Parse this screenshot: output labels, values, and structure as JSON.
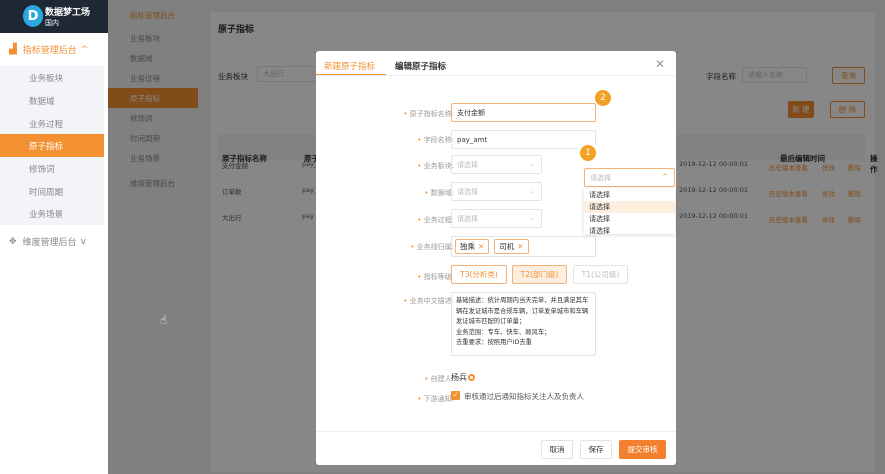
{
  "app": {
    "name": "数据梦工场",
    "region": "国内"
  },
  "nav": {
    "group1": "指标管理后台",
    "items": [
      "业务板块",
      "数据域",
      "业务过程",
      "原子指标",
      "修饰词",
      "时间周期",
      "业务场景"
    ],
    "active": 3,
    "group2": "维度管理后台"
  },
  "page": {
    "title": "原子指标",
    "filter_label": "业务板块",
    "filter_value": "大出行",
    "field_label": "字段名称",
    "field_placeholder": "请输入名称",
    "query": "查询",
    "new": "新 建",
    "delete": "删 除",
    "columns": [
      "原子指标名称",
      "原子",
      "最后编辑时间",
      "操作"
    ],
    "rows": [
      {
        "name": "支付金额",
        "code": "pay_",
        "time": "2019-12-12 00:00:01"
      },
      {
        "name": "订单数",
        "code": "pay_",
        "time": "2019-12-12 00:00:01"
      },
      {
        "name": "大出行",
        "code": "pay",
        "time": "2019-12-12 00:00:01"
      }
    ],
    "ops": [
      "历史版本查看",
      "修改",
      "删除"
    ]
  },
  "modal": {
    "tabs": [
      "新建原子指标",
      "编辑原子指标"
    ],
    "active_tab": 0,
    "labels": {
      "name": "原子指标名称:",
      "field": "字段名称:",
      "biz": "业务板块:",
      "domain": "数据域:",
      "process": "业务过程:",
      "line": "业务线归属:",
      "level": "指标等级:",
      "desc": "业务中文描述:",
      "creator": "创建人:",
      "notify": "下游通知:"
    },
    "name_value": "支付金额",
    "field_value": "pay_amt",
    "select_placeholder": "请选择",
    "tags": [
      "独乘",
      "司机"
    ],
    "levels": [
      "T3(分析类)",
      "T2(部门级)",
      "T1(公司级)"
    ],
    "desc_lines": [
      "基础描述：统计周期内当天完单，并且满足其车",
      "辆在发证城市是合规车辆，订单发单城市和车辆",
      "发证城市匹配的订单量；",
      "业务范围：专车、快车、顺风车；",
      "去重要求：按照用户ID去重"
    ],
    "creator": "杨兵",
    "notify_text": "审核通过后通知指标关注人及负责人",
    "notify_checked": true,
    "cancel": "取消",
    "save": "保存",
    "submit": "提交审核",
    "dropdown": {
      "placeholder": "请选择",
      "options": [
        "请选择",
        "请选择",
        "请选择",
        "请选择"
      ],
      "highlighted": 1
    },
    "badges": [
      "1",
      "2"
    ]
  },
  "colors": {
    "accent": "#f39032",
    "sidebar_dark": "#1e2935"
  }
}
